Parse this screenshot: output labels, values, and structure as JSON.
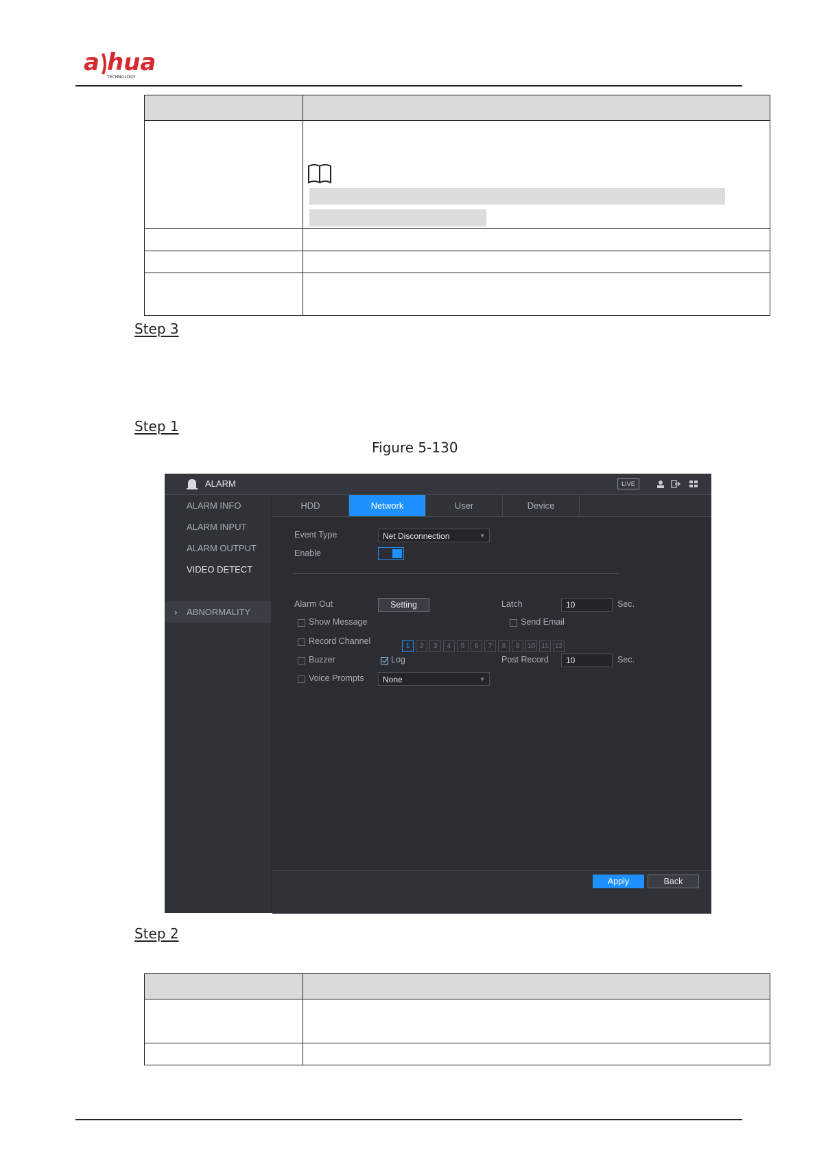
{
  "header": {
    "logo_text": "alhua",
    "logo_subtext": "TECHNOLOGY",
    "logo_color": "#d7282f"
  },
  "steps": {
    "step3": "Step 3",
    "step1": "Step 1",
    "step2": "Step 2"
  },
  "figure": {
    "caption": "Figure 5-130"
  },
  "ui": {
    "title": "ALARM",
    "live_badge": "LIVE",
    "sidebar": [
      {
        "label": "ALARM INFO",
        "active": false
      },
      {
        "label": "ALARM INPUT",
        "active": false
      },
      {
        "label": "ALARM OUTPUT",
        "active": false
      },
      {
        "label": "VIDEO DETECT",
        "active": false
      },
      {
        "label": "ABNORMALITY",
        "active": true
      }
    ],
    "sidebar_arrow": "›",
    "tabs": [
      {
        "label": "HDD",
        "selected": false
      },
      {
        "label": "Network",
        "selected": true
      },
      {
        "label": "User",
        "selected": false
      },
      {
        "label": "Device",
        "selected": false
      }
    ],
    "form": {
      "event_type_label": "Event Type",
      "event_type_value": "Net Disconnection",
      "enable_label": "Enable",
      "enable_on": true,
      "alarm_out_label": "Alarm Out",
      "setting_button": "Setting",
      "latch_label": "Latch",
      "latch_value": "10",
      "latch_unit": "Sec.",
      "show_message_label": "Show Message",
      "show_message_checked": false,
      "send_email_label": "Send Email",
      "send_email_checked": false,
      "record_channel_label": "Record Channel",
      "record_channel_checked": false,
      "channels": [
        "1",
        "2",
        "3",
        "4",
        "5",
        "6",
        "7",
        "8",
        "9",
        "10",
        "11",
        "12"
      ],
      "channel_selected": "1",
      "buzzer_label": "Buzzer",
      "buzzer_checked": false,
      "log_label": "Log",
      "log_checked": true,
      "post_record_label": "Post Record",
      "post_record_value": "10",
      "post_record_unit": "Sec.",
      "voice_prompts_label": "Voice Prompts",
      "voice_prompts_checked": false,
      "voice_prompts_value": "None"
    },
    "footer": {
      "apply": "Apply",
      "back": "Back"
    },
    "accent_color": "#1e90ff"
  }
}
